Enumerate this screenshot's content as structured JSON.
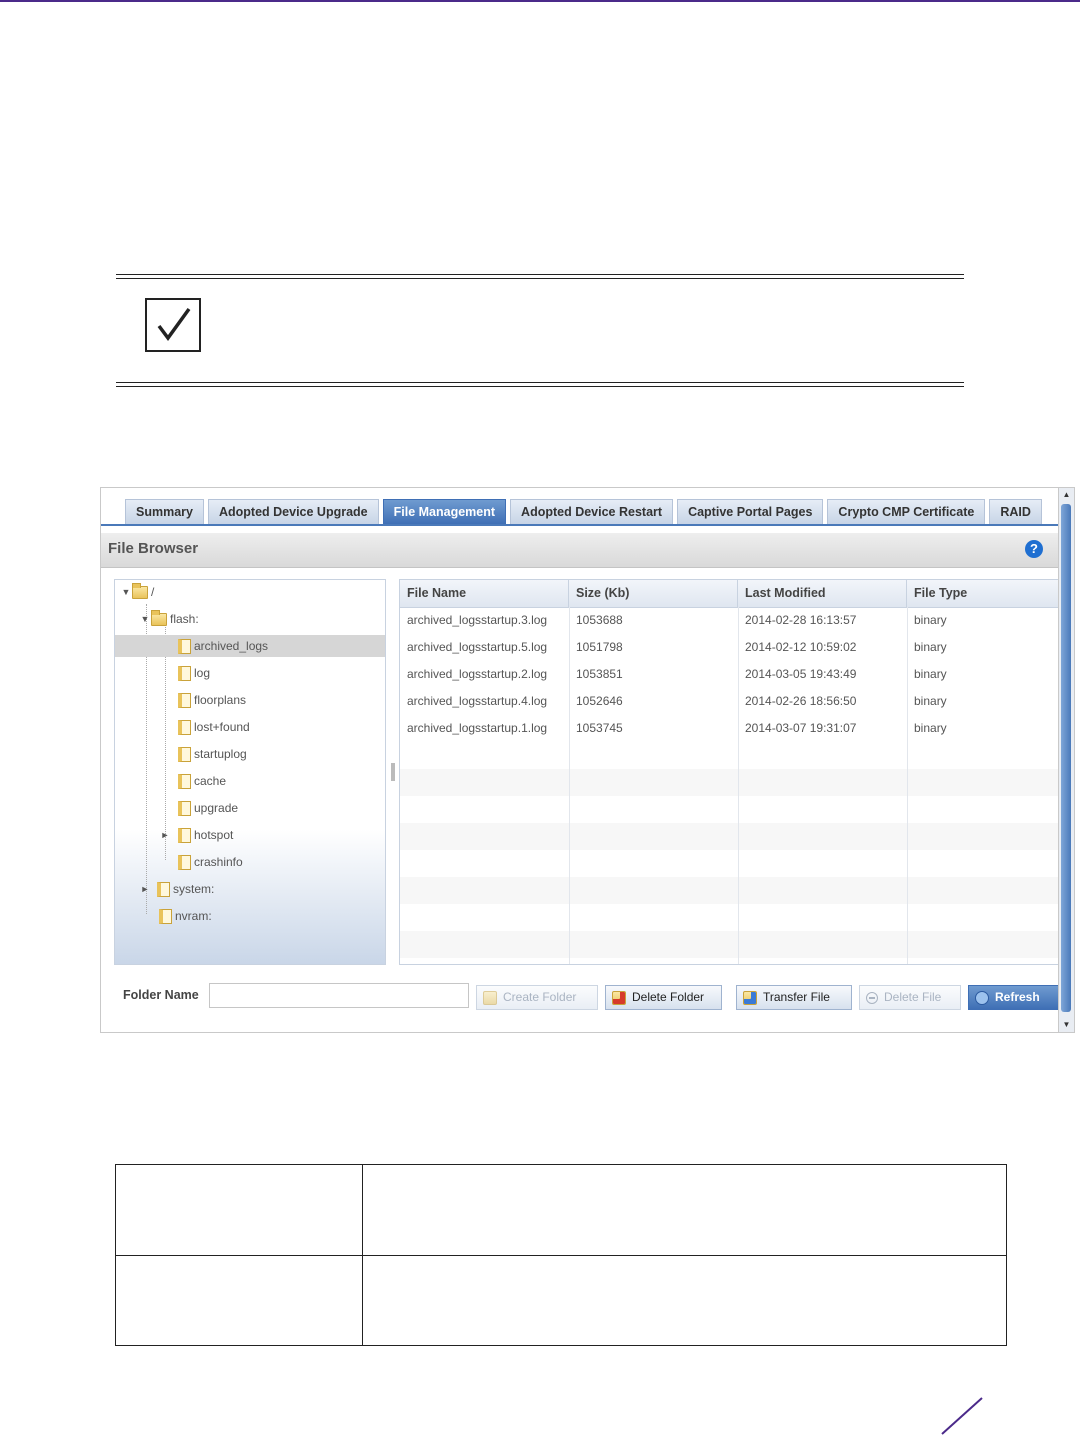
{
  "tabs": [
    {
      "label": "Summary",
      "active": false
    },
    {
      "label": "Adopted Device Upgrade",
      "active": false
    },
    {
      "label": "File Management",
      "active": true
    },
    {
      "label": "Adopted Device Restart",
      "active": false
    },
    {
      "label": "Captive Portal Pages",
      "active": false
    },
    {
      "label": "Crypto CMP Certificate",
      "active": false
    },
    {
      "label": "RAID",
      "active": false
    }
  ],
  "file_browser": {
    "title": "File Browser",
    "help_icon": "?"
  },
  "tree": {
    "root": "/",
    "flash": "flash:",
    "flash_children": [
      "archived_logs",
      "log",
      "floorplans",
      "lost+found",
      "startuplog",
      "cache",
      "upgrade",
      "hotspot",
      "crashinfo"
    ],
    "selected": "archived_logs",
    "system": "system:",
    "nvram": "nvram:"
  },
  "grid": {
    "columns": [
      "File Name",
      "Size (Kb)",
      "Last Modified",
      "File Type"
    ],
    "rows": [
      [
        "archived_logsstartup.3.log",
        "1053688",
        "2014-02-28 16:13:57",
        "binary"
      ],
      [
        "archived_logsstartup.5.log",
        "1051798",
        "2014-02-12 10:59:02",
        "binary"
      ],
      [
        "archived_logsstartup.2.log",
        "1053851",
        "2014-03-05 19:43:49",
        "binary"
      ],
      [
        "archived_logsstartup.4.log",
        "1052646",
        "2014-02-26 18:56:50",
        "binary"
      ],
      [
        "archived_logsstartup.1.log",
        "1053745",
        "2014-03-07 19:31:07",
        "binary"
      ]
    ]
  },
  "controls": {
    "folder_name_label": "Folder Name",
    "folder_name_value": "",
    "create_folder": "Create Folder",
    "delete_folder": "Delete Folder",
    "transfer_file": "Transfer File",
    "delete_file": "Delete File",
    "refresh": "Refresh"
  },
  "colors": {
    "accent": "#4b2a8a",
    "tab_active": "#3f6fb5"
  }
}
